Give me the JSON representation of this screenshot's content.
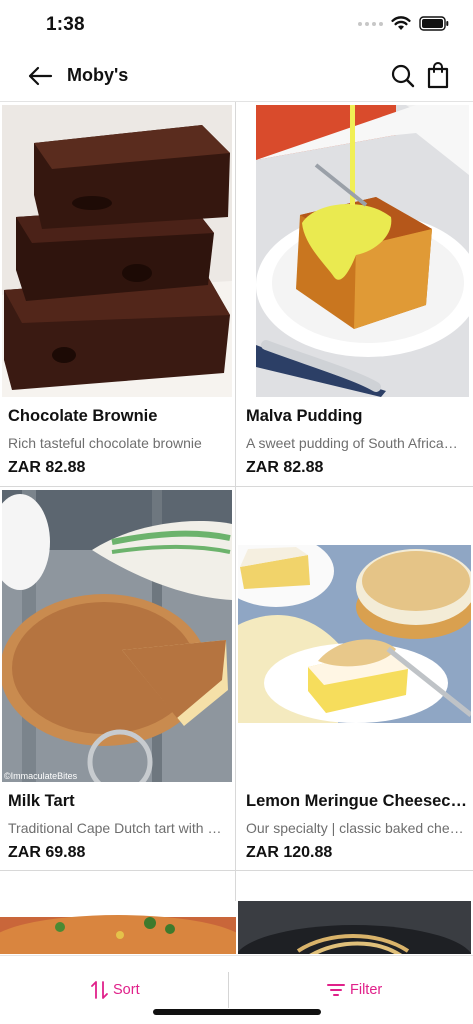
{
  "status_bar": {
    "time": "1:38"
  },
  "header": {
    "title": "Moby's",
    "back_icon": "arrow-left-icon",
    "search_icon": "search-icon",
    "cart_icon": "shopping-bag-icon"
  },
  "products": [
    {
      "name": "Chocolate Brownie",
      "description": "Rich tasteful chocolate brownie",
      "price": "ZAR 82.88"
    },
    {
      "name": "Malva Pudding",
      "description": "A sweet pudding of South African origin",
      "price": "ZAR 82.88"
    },
    {
      "name": "Milk Tart",
      "description": "Traditional Cape Dutch tart with milk",
      "price": "ZAR 69.88"
    },
    {
      "name": "Lemon Meringue Cheesecake",
      "description": "Our specialty | classic baked cheesecake",
      "price": "ZAR 120.88"
    }
  ],
  "watermark": "©ImmaculateBites",
  "bottom_bar": {
    "sort_label": "Sort",
    "filter_label": "Filter"
  },
  "colors": {
    "accent": "#e0218a",
    "text": "#111111",
    "muted": "#6e6e6e"
  }
}
